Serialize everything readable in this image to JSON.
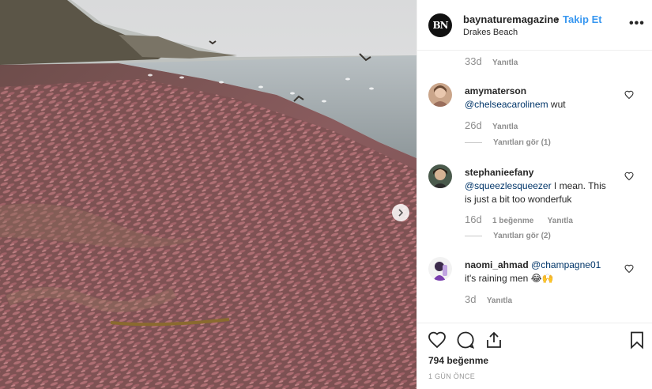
{
  "post": {
    "author": "baynaturemagazine",
    "author_avatar_text": "BN",
    "follow_label": "Takip Et",
    "separator": "•",
    "location": "Drakes Beach",
    "more_icon": "more-horizontal-icon",
    "likes": "794 beğenme",
    "time_ago": "1 GÜN ÖNCE"
  },
  "comments": [
    {
      "time": "33d",
      "reply_label": "Yanıtla"
    },
    {
      "user": "amymaterson",
      "mention": "@chelseacarolinem",
      "text": " wut",
      "time": "26d",
      "reply_label": "Yanıtla",
      "view_replies": "Yanıtları gör (1)"
    },
    {
      "user": "stephanieefany",
      "mention": "@squeezlesqueezer",
      "text": " I mean. This is just a bit too wonderfuk",
      "time": "16d",
      "likes_label": "1 beğenme",
      "reply_label": "Yanıtla",
      "view_replies": "Yanıtları gör (2)"
    },
    {
      "user": "naomi_ahmad",
      "mention": "@champagne01",
      "text": "it's raining men 😂🙌",
      "time": "3d",
      "reply_label": "Yanıtla"
    }
  ],
  "colors": {
    "accent": "#3897f0",
    "mention": "#003569",
    "muted": "#8e8e8e"
  }
}
